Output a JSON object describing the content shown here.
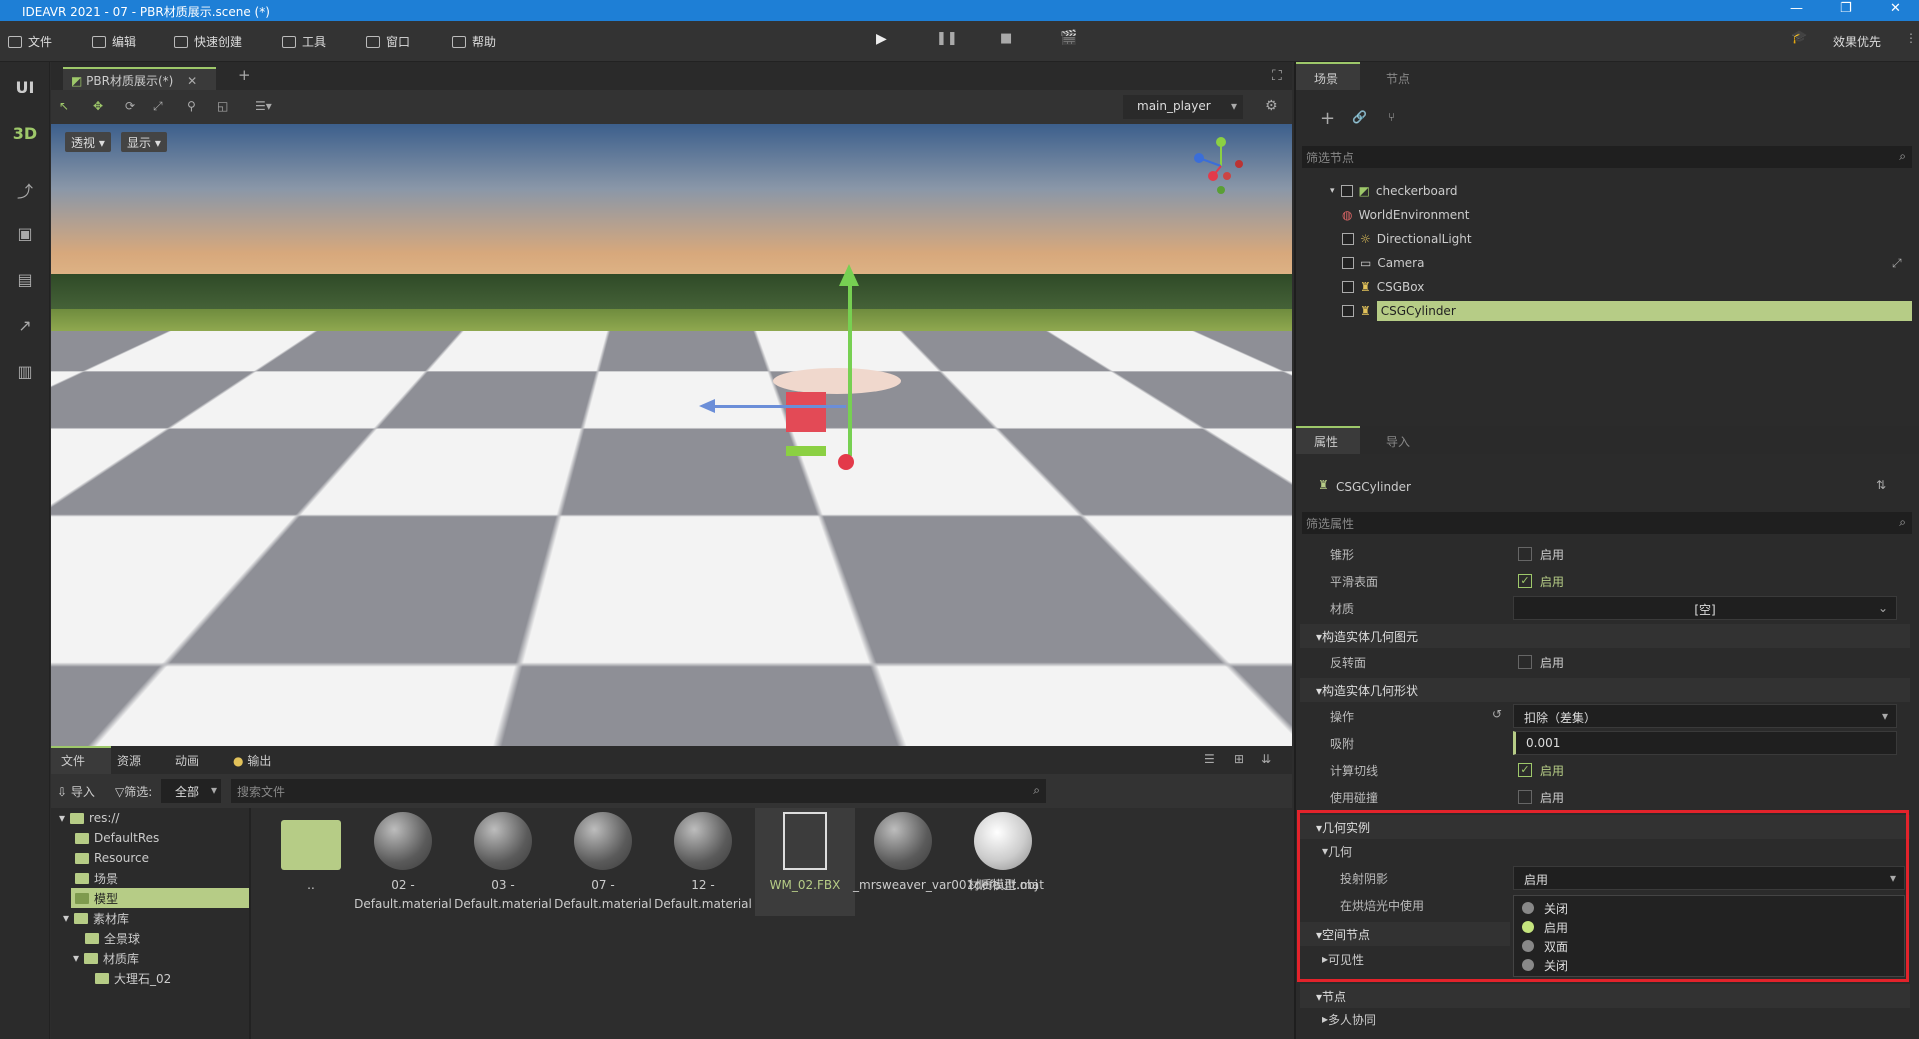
{
  "titlebar": {
    "title": "IDEAVR 2021 - 07 - PBR材质展示.scene (*)"
  },
  "menu": [
    "文件",
    "编辑",
    "快速创建",
    "工具",
    "窗口",
    "帮助"
  ],
  "menu_right": "效果优先",
  "left_bar": {
    "ui": "UI",
    "three_d": "3D"
  },
  "editor_tab": "PBR材质展示(*)",
  "player_select": "main_player",
  "viewport_buttons": {
    "view": "透视",
    "display": "显示"
  },
  "bottom": {
    "tabs": [
      "文件",
      "资源",
      "动画",
      "输出"
    ],
    "import": "导入",
    "filter": "筛选:",
    "filter_value": "全部",
    "search_placeholder": "搜索文件",
    "tree": [
      "res://",
      "DefaultRes",
      "Resource",
      "场景",
      "模型",
      "素材库",
      "全景球",
      "材质库",
      "大理石_02"
    ],
    "files": [
      {
        "name": ".."
      },
      {
        "name": "02 - Default.material"
      },
      {
        "name": "03 - Default.material"
      },
      {
        "name": "07 - Default.material"
      },
      {
        "name": "12 - Default.material"
      },
      {
        "name": "WM_02.FBX"
      },
      {
        "name": "_mrsweaver_var001default.mat"
      },
      {
        "name": "材质模型.obj"
      }
    ]
  },
  "scene_panel": {
    "tabs": [
      "场景",
      "节点"
    ],
    "filter_placeholder": "筛选节点",
    "nodes": [
      "checkerboard",
      "WorldEnvironment",
      "DirectionalLight",
      "Camera",
      "CSGBox",
      "CSGCylinder"
    ]
  },
  "inspector": {
    "tabs": [
      "属性",
      "导入"
    ],
    "object": "CSGCylinder",
    "filter_placeholder": "筛选属性",
    "cone_label": "锥形",
    "cone_value": "启用",
    "smooth_label": "平滑表面",
    "smooth_value": "启用",
    "material_label": "材质",
    "material_value": "[空]",
    "sec_primitive": "构造实体几何图元",
    "flip_label": "反转面",
    "flip_value": "启用",
    "sec_shape": "构造实体几何形状",
    "op_label": "操作",
    "op_value": "扣除（差集）",
    "snap_label": "吸附",
    "snap_value": "0.001",
    "tangent_label": "计算切线",
    "tangent_value": "启用",
    "collision_label": "使用碰撞",
    "collision_value": "启用",
    "sec_geom_instance": "几何实例",
    "sub_geom": "几何",
    "cast_shadow_label": "投射阴影",
    "cast_shadow_value": "启用",
    "baked_label": "在烘焙光中使用",
    "sec_spatial": "空间节点",
    "visibility": "可见性",
    "sec_node": "节点",
    "multiplayer": "多人协同",
    "dropdown_options": [
      "关闭",
      "启用",
      "双面",
      "关闭"
    ]
  }
}
